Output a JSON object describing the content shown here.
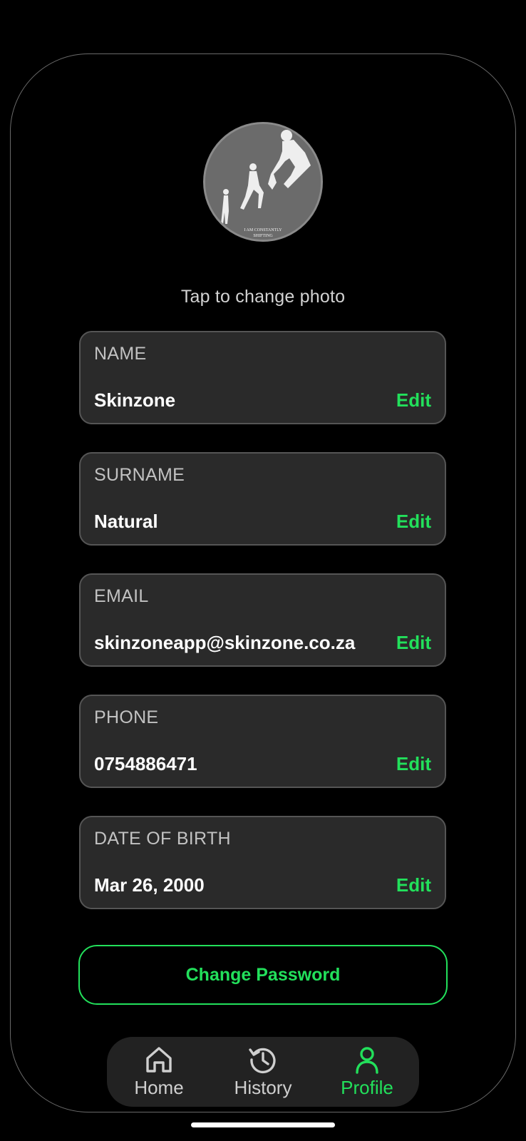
{
  "profile": {
    "avatar_caption_line1": "I AM CONSTANTLY",
    "avatar_caption_line2": "SHIFTING",
    "photo_hint": "Tap to change photo"
  },
  "fields": [
    {
      "label": "NAME",
      "value": "Skinzone",
      "edit_label": "Edit"
    },
    {
      "label": "SURNAME",
      "value": "Natural",
      "edit_label": "Edit"
    },
    {
      "label": "EMAIL",
      "value": "skinzoneapp@skinzone.co.za",
      "edit_label": "Edit"
    },
    {
      "label": "PHONE",
      "value": "0754886471",
      "edit_label": "Edit"
    },
    {
      "label": "DATE OF BIRTH",
      "value": "Mar 26, 2000",
      "edit_label": "Edit"
    }
  ],
  "actions": {
    "change_password_label": "Change Password"
  },
  "nav": {
    "items": [
      {
        "label": "Home",
        "icon": "home-icon",
        "active": false
      },
      {
        "label": "History",
        "icon": "history-icon",
        "active": false
      },
      {
        "label": "Profile",
        "icon": "profile-icon",
        "active": true
      }
    ]
  },
  "colors": {
    "accent": "#22e05b",
    "background": "#000000",
    "card": "#2a2a2a",
    "nav_background": "#222222"
  }
}
